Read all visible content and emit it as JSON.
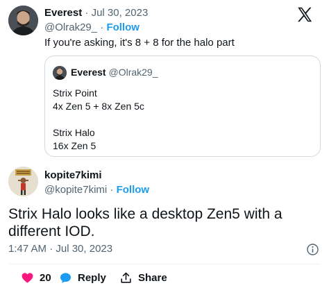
{
  "parent_tweet": {
    "author_name": "Everest",
    "date_separator": "·",
    "date": "Jul 30, 2023",
    "handle": "@Olrak29_",
    "follow_separator": "·",
    "follow_label": "Follow",
    "text": "If you're asking, it's 8 + 8 for the halo part",
    "quoted_tweet": {
      "author_name": "Everest",
      "handle": "@Olrak29_",
      "lines": [
        "Strix Point",
        "4x Zen 5 + 8x Zen 5c",
        "",
        "Strix Halo",
        "16x Zen 5"
      ]
    }
  },
  "main_tweet": {
    "author_name": "kopite7kimi",
    "handle": "@kopite7kimi",
    "follow_separator": "·",
    "follow_label": "Follow",
    "text": "Strix Halo looks like a desktop Zen5 with a different IOD.",
    "timestamp": "1:47 AM · Jul 30, 2023",
    "actions": {
      "like_count": "20",
      "reply_label": "Reply",
      "share_label": "Share"
    }
  },
  "icons": {
    "brand": "x-logo-icon",
    "like": "heart-icon",
    "reply": "speech-bubble-icon",
    "share": "share-icon",
    "info": "info-icon"
  },
  "colors": {
    "link": "#1d9bf0",
    "like": "#f91880",
    "text": "#0f1419",
    "muted": "#536471",
    "border": "#cfd9de"
  }
}
